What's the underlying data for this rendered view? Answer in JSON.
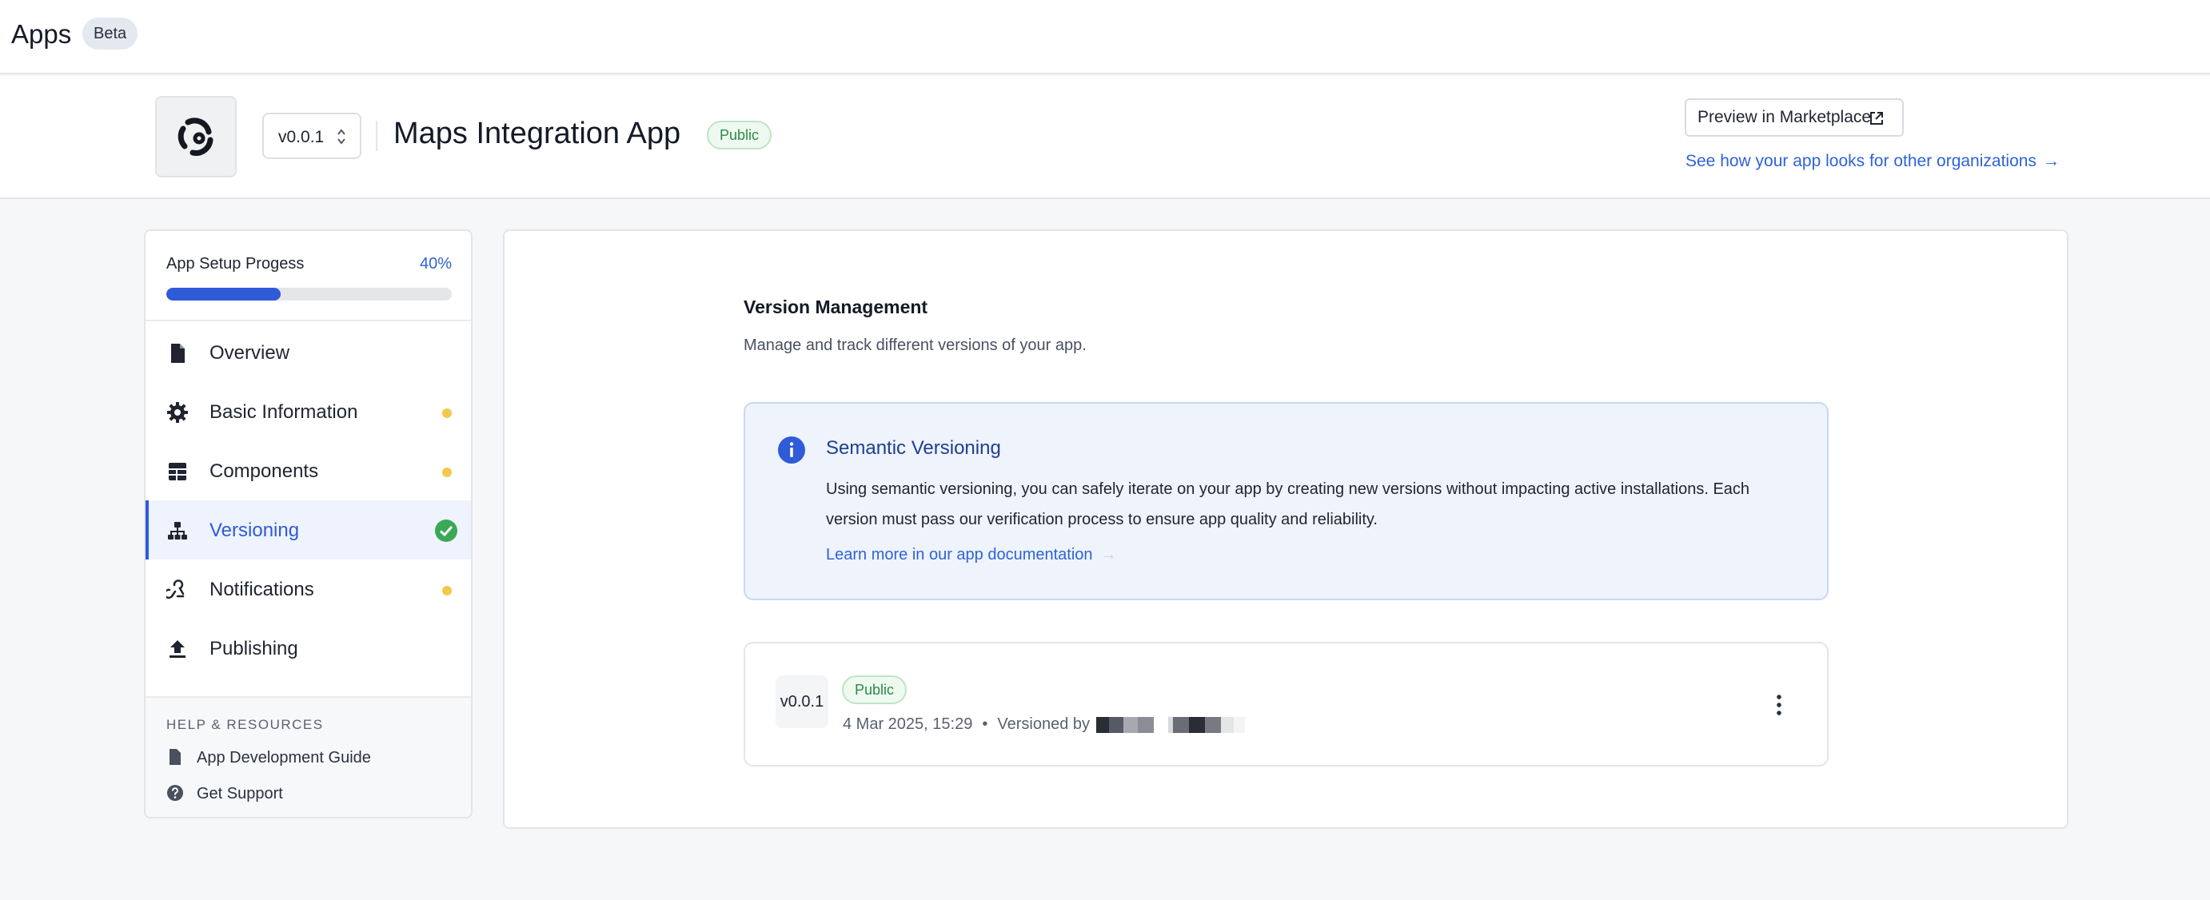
{
  "topbar": {
    "title": "Apps",
    "badge": "Beta"
  },
  "header": {
    "version": "v0.0.1",
    "app_name": "Maps Integration App",
    "visibility": "Public",
    "preview_button": "Preview in Marketplace",
    "see_link": "See how your app looks for other organizations",
    "see_link_arrow": "→"
  },
  "sidebar": {
    "progress": {
      "label": "App Setup Progess",
      "percent_text": "40%",
      "value": 40
    },
    "items": [
      {
        "label": "Overview",
        "icon": "document-icon",
        "status": "none"
      },
      {
        "label": "Basic Information",
        "icon": "gear-icon",
        "status": "pending"
      },
      {
        "label": "Components",
        "icon": "table-icon",
        "status": "pending"
      },
      {
        "label": "Versioning",
        "icon": "sitemap-icon",
        "status": "complete",
        "active": true
      },
      {
        "label": "Notifications",
        "icon": "webhook-icon",
        "status": "pending"
      },
      {
        "label": "Publishing",
        "icon": "upload-icon",
        "status": "none"
      }
    ],
    "resources": {
      "heading": "HELP & RESOURCES",
      "items": [
        {
          "label": "App Development Guide",
          "icon": "document-icon"
        },
        {
          "label": "Get Support",
          "icon": "question-circle-icon"
        }
      ]
    }
  },
  "main": {
    "title": "Version Management",
    "subtitle": "Manage and track different versions of your app.",
    "info": {
      "title": "Semantic Versioning",
      "body": "Using semantic versioning, you can safely iterate on your app by creating new versions without impacting active installations. Each version must pass our verification process to ensure app quality and reliability.",
      "link": "Learn more in our app documentation",
      "link_arrow": "→"
    },
    "versions": [
      {
        "tag": "v0.0.1",
        "status": "Public",
        "date": "4 Mar 2025, 15:29",
        "separator": "•",
        "versioned_by_label": "Versioned by"
      }
    ]
  },
  "colors": {
    "accent": "#2f5bd8",
    "link": "#2f63d6",
    "pending_dot": "#f2c94c",
    "success": "#3aa856",
    "public_badge_text": "#2d8a45"
  }
}
